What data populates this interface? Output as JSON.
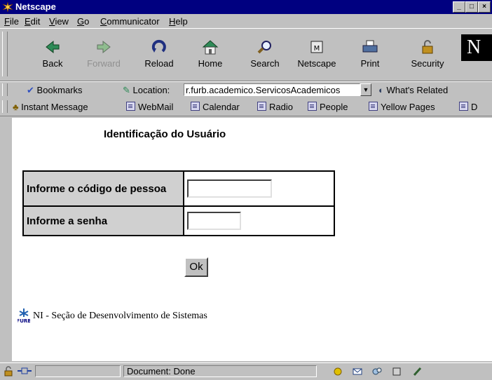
{
  "window": {
    "title": "Netscape",
    "controls": [
      "_",
      "□",
      "×"
    ]
  },
  "menu": [
    "File",
    "Edit",
    "View",
    "Go",
    "Communicator",
    "Help"
  ],
  "nav_buttons": [
    {
      "label": "Back",
      "icon": "back-arrow-icon",
      "enabled": true
    },
    {
      "label": "Forward",
      "icon": "forward-arrow-icon",
      "enabled": false
    },
    {
      "label": "Reload",
      "icon": "reload-icon",
      "enabled": true
    },
    {
      "label": "Home",
      "icon": "home-icon",
      "enabled": true
    },
    {
      "label": "Search",
      "icon": "search-icon",
      "enabled": true
    },
    {
      "label": "Netscape",
      "icon": "netscape-icon",
      "enabled": true
    },
    {
      "label": "Print",
      "icon": "print-icon",
      "enabled": true
    },
    {
      "label": "Security",
      "icon": "security-lock-icon",
      "enabled": true
    }
  ],
  "logo_letter": "N",
  "location": {
    "bookmarks_label": "Bookmarks",
    "location_label": "Location:",
    "url": "r.furb.academico.ServicosAcademicos",
    "related_label": "What's Related"
  },
  "personal_toolbar": [
    "Instant Message",
    "WebMail",
    "Calendar",
    "Radio",
    "People",
    "Yellow Pages",
    "D"
  ],
  "page": {
    "heading": "Identificação do Usuário",
    "code_label": "Informe o código de pessoa",
    "password_label": "Informe a senha",
    "ok_label": "Ok",
    "footer": "NI - Seção de Desenvolvimento de Sistemas",
    "footer_logo_text": "FURB"
  },
  "status": {
    "text": "Document: Done"
  },
  "colors": {
    "titlebar": "#000080",
    "chrome": "#c0c0c0",
    "label_cell": "#d0d0d0"
  }
}
